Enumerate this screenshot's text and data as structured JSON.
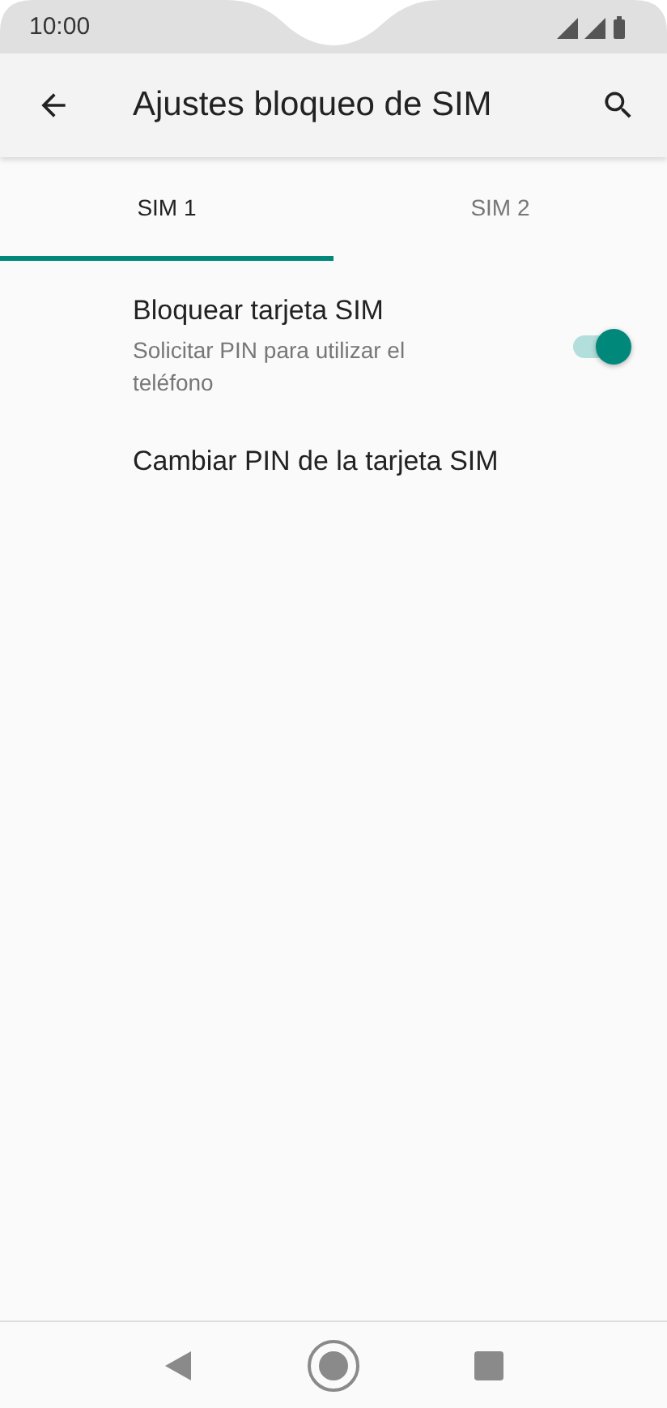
{
  "status_bar": {
    "time": "10:00"
  },
  "app_bar": {
    "title": "Ajustes bloqueo de SIM"
  },
  "tabs": [
    {
      "label": "SIM 1",
      "selected": true
    },
    {
      "label": "SIM 2",
      "selected": false
    }
  ],
  "settings": [
    {
      "kind": "toggle",
      "title": "Bloquear tarjeta SIM",
      "subtitle": "Solicitar PIN para utilizar el teléfono",
      "on": true
    },
    {
      "kind": "action",
      "title": "Cambiar PIN de la tarjeta SIM"
    }
  ]
}
